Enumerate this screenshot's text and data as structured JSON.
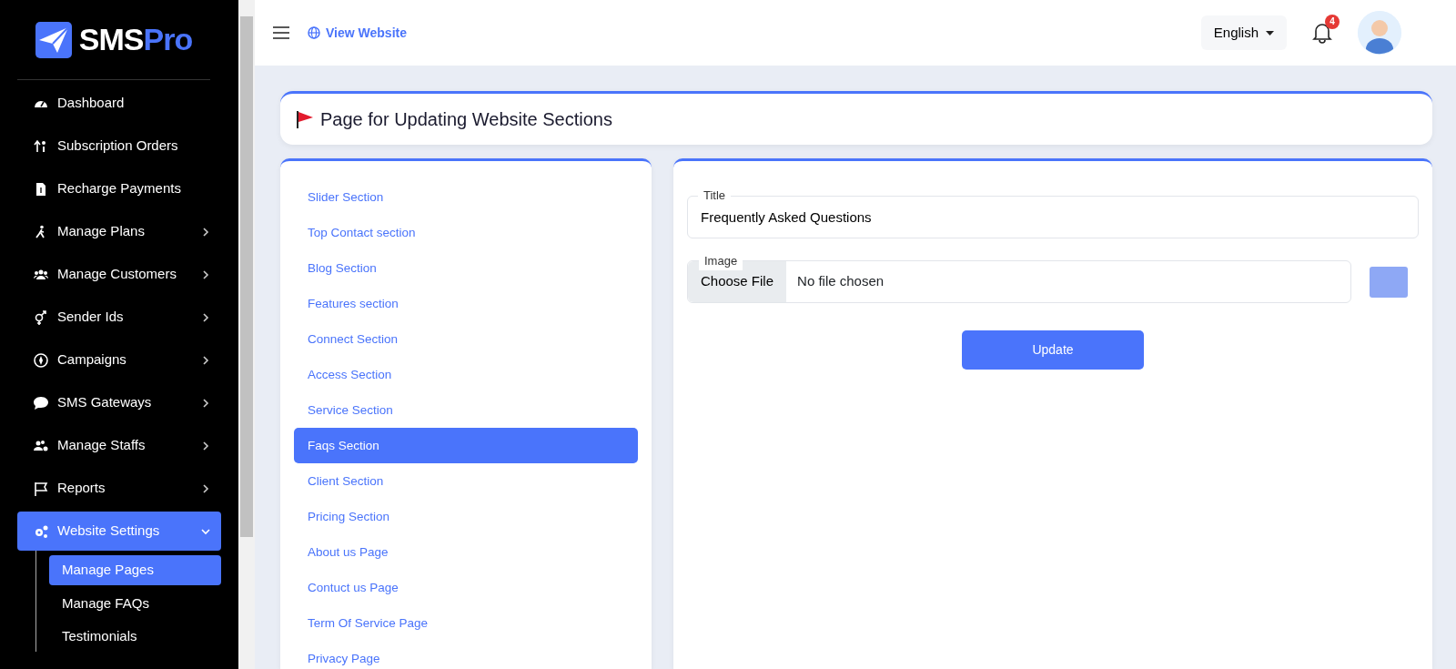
{
  "brand": {
    "part_1": "SMS",
    "part_2": "Pro"
  },
  "sidebar": {
    "items": [
      {
        "kind": "dashboard",
        "label": "Dashboard",
        "selected": false
      },
      {
        "kind": "orders",
        "label": "Subscription Orders",
        "selected": false
      },
      {
        "kind": "invoice",
        "label": "Recharge Payments",
        "selected": false
      },
      {
        "kind": "walk",
        "label": "Manage Plans",
        "selected": false,
        "expanded": false
      },
      {
        "kind": "users",
        "label": "Manage Customers",
        "selected": false,
        "expanded": false
      },
      {
        "kind": "gender",
        "label": "Sender Ids",
        "selected": false,
        "expanded": false
      },
      {
        "kind": "compass",
        "label": "Campaigns",
        "selected": false,
        "expanded": false
      },
      {
        "kind": "chat",
        "label": "SMS Gateways",
        "selected": false,
        "expanded": false
      },
      {
        "kind": "staff",
        "label": "Manage Staffs",
        "selected": false,
        "expanded": false
      },
      {
        "kind": "flag",
        "label": "Reports",
        "selected": false,
        "expanded": false
      },
      {
        "kind": "gears",
        "label": "Website Settings",
        "selected": true,
        "expanded": true,
        "children": [
          {
            "label": "Manage Pages",
            "selected": true
          },
          {
            "label": "Manage FAQs",
            "selected": false
          },
          {
            "label": "Testimonials",
            "selected": false
          }
        ]
      }
    ]
  },
  "topbar": {
    "view_website": "View Website",
    "language": "English",
    "notifications": "4"
  },
  "page_title": "Page for Updating Website Sections",
  "sections": [
    {
      "label": "Slider Section",
      "selected": false
    },
    {
      "label": "Top Contact section",
      "selected": false
    },
    {
      "label": "Blog Section",
      "selected": false
    },
    {
      "label": "Features section",
      "selected": false
    },
    {
      "label": "Connect Section",
      "selected": false
    },
    {
      "label": "Access Section",
      "selected": false
    },
    {
      "label": "Service Section",
      "selected": false
    },
    {
      "label": "Faqs Section",
      "selected": true
    },
    {
      "label": "Client Section",
      "selected": false
    },
    {
      "label": "Pricing Section",
      "selected": false
    },
    {
      "label": "About us Page",
      "selected": false
    },
    {
      "label": "Contuct us Page",
      "selected": false
    },
    {
      "label": "Term Of Service Page",
      "selected": false
    },
    {
      "label": "Privacy Page",
      "selected": false
    }
  ],
  "form": {
    "title_label": "Title",
    "title_value": "Frequently Asked Questions",
    "image_label": "Image",
    "choose_file": "Choose File",
    "file_status": "No file chosen",
    "submit": "Update"
  }
}
